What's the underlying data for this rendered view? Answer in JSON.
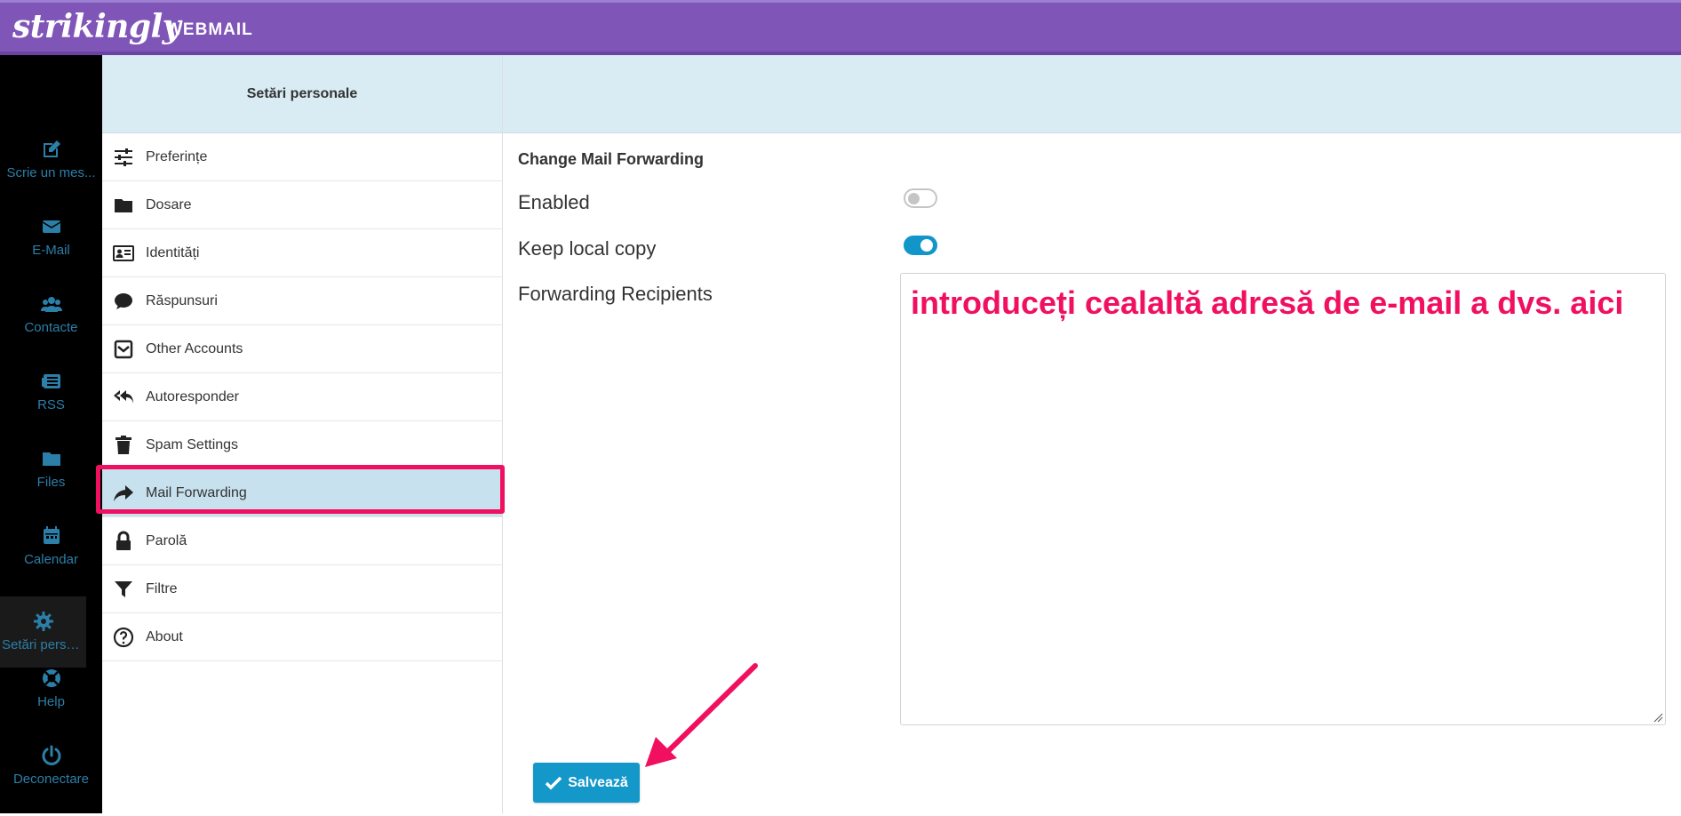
{
  "header": {
    "logo": "strikingly",
    "product": "WEBMAIL"
  },
  "nav": [
    {
      "label": "Scrie un mes...",
      "icon": "compose-icon"
    },
    {
      "label": "E-Mail",
      "icon": "envelope-icon"
    },
    {
      "label": "Contacte",
      "icon": "contacts-icon"
    },
    {
      "label": "RSS",
      "icon": "rss-icon"
    },
    {
      "label": "Files",
      "icon": "folder-icon"
    },
    {
      "label": "Calendar",
      "icon": "calendar-icon"
    },
    {
      "label": "Setări perso...",
      "icon": "gear-icon",
      "active": true
    },
    {
      "label": "Help",
      "icon": "lifebuoy-icon"
    },
    {
      "label": "Deconectare",
      "icon": "power-icon"
    }
  ],
  "settings": {
    "title": "Setări personale",
    "items": [
      {
        "label": "Preferințe",
        "icon": "sliders-icon"
      },
      {
        "label": "Dosare",
        "icon": "folder-icon"
      },
      {
        "label": "Identități",
        "icon": "id-card-icon"
      },
      {
        "label": "Răspunsuri",
        "icon": "speech-bubble-icon"
      },
      {
        "label": "Other Accounts",
        "icon": "inbox-icon"
      },
      {
        "label": "Autoresponder",
        "icon": "reply-all-icon"
      },
      {
        "label": "Spam Settings",
        "icon": "trash-icon"
      },
      {
        "label": "Mail Forwarding",
        "icon": "share-arrow-icon",
        "selected": true
      },
      {
        "label": "Parolă",
        "icon": "lock-icon"
      },
      {
        "label": "Filtre",
        "icon": "filter-icon"
      },
      {
        "label": "About",
        "icon": "question-circle-icon"
      }
    ]
  },
  "form": {
    "title": "Change Mail Forwarding",
    "enabled_label": "Enabled",
    "enabled": false,
    "keep_copy_label": "Keep local copy",
    "keep_copy": true,
    "recipients_label": "Forwarding Recipients",
    "recipients_hint": "introduceți cealaltă adresă de e-mail a dvs. aici",
    "save_label": "Salvează"
  },
  "colors": {
    "header": "#8055b8",
    "accent": "#1497c9",
    "highlight": "#f0105f",
    "selected_bg": "#c7e1ee"
  }
}
